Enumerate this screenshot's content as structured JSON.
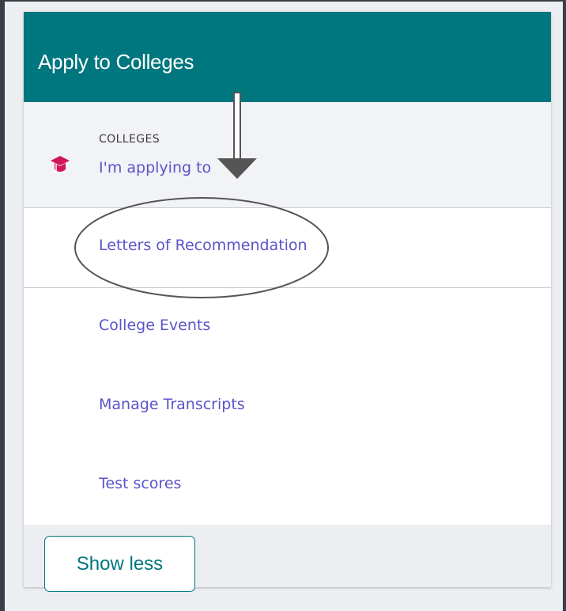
{
  "card": {
    "title": "Apply to Colleges"
  },
  "colleges": {
    "eyebrow": "COLLEGES",
    "link_label": "I'm applying to",
    "icon": "graduation-cap-icon"
  },
  "menu": [
    {
      "label": "Letters of Recommendation"
    },
    {
      "label": "College Events"
    },
    {
      "label": "Manage Transcripts"
    },
    {
      "label": "Test scores"
    }
  ],
  "footer": {
    "show_less_label": "Show less"
  },
  "annotations": {
    "arrow": "down-arrow-annotation",
    "circle": "ellipse-highlight-annotation"
  },
  "colors": {
    "header_bg": "#00767e",
    "link": "#5a54c9",
    "icon": "#d4145a"
  }
}
